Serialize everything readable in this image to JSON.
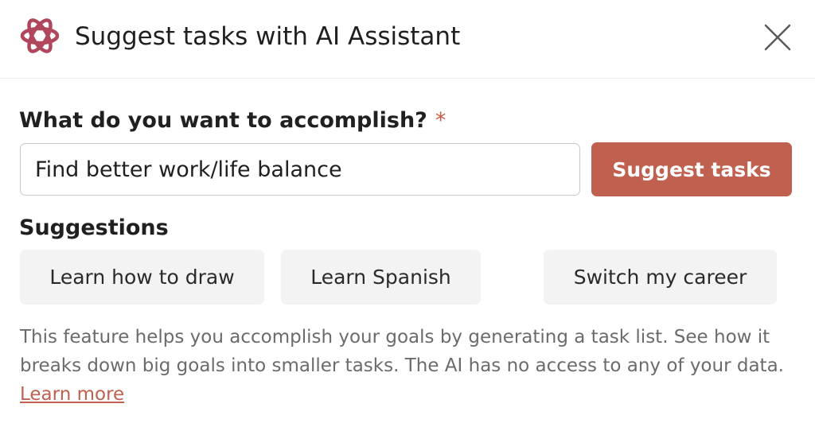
{
  "dialog": {
    "title": "Suggest tasks with AI Assistant",
    "logo_icon": "openai-knot-icon",
    "close_icon": "close-icon",
    "accent_color": "#c0604e"
  },
  "form": {
    "question_label": "What do you want to accomplish?",
    "required_marker": "*",
    "input_value": "Find better work/life balance",
    "submit_label": "Suggest tasks"
  },
  "suggestions": {
    "heading": "Suggestions",
    "items": [
      {
        "label": "Learn how to draw"
      },
      {
        "label": "Learn Spanish"
      },
      {
        "label": "Switch my career"
      }
    ]
  },
  "info": {
    "text": "This feature helps you accomplish your goals by generating a task list. See how it breaks down big goals into smaller tasks. The AI has no access to any of your data. ",
    "link_label": "Learn more"
  }
}
